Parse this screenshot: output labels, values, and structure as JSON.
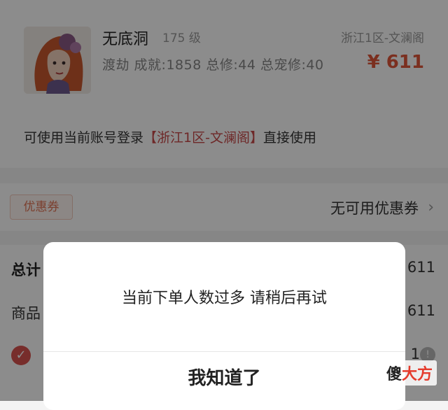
{
  "product": {
    "name": "无底洞",
    "level": "175 级",
    "server": "浙江1区-文澜阁",
    "stats": "渡劫  成就:1858  总修:44  总宠修:40",
    "price": "¥ 611"
  },
  "login_note": {
    "prefix": "可使用当前账号登录",
    "highlight": "【浙江1区-文澜阁】",
    "suffix": "直接使用"
  },
  "coupon": {
    "badge": "优惠券",
    "text": "无可用优惠券"
  },
  "summary": {
    "total_label": "总计",
    "total_value": "611",
    "goods_label": "商品",
    "goods_value": "611",
    "row3_value": "1"
  },
  "dialog": {
    "message": "当前下单人数过多 请稍后再试",
    "button": "我知道了"
  },
  "watermark": {
    "left": "傻",
    "right": "大方"
  },
  "colors": {
    "accent": "#e0563a",
    "highlight": "#c94a4a"
  }
}
